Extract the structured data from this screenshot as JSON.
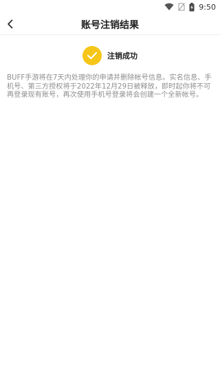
{
  "status_bar": {
    "time": "9:50",
    "icons": [
      "wifi-icon",
      "no-sim-icon",
      "battery-charging-icon"
    ]
  },
  "nav": {
    "title": "账号注销结果",
    "back_icon": "chevron-left-icon"
  },
  "result": {
    "icon": "check-icon",
    "label": "注销成功",
    "accent_color": "#f5c518"
  },
  "description": "BUFF手游将在7天内处理你的申请并删除帐号信息。实名信息、手机号、第三方授权将于2022年12月29日被释放，即时起你将不可再登录现有账号，再次使用手机号登录将会创建一个全新帐号。"
}
